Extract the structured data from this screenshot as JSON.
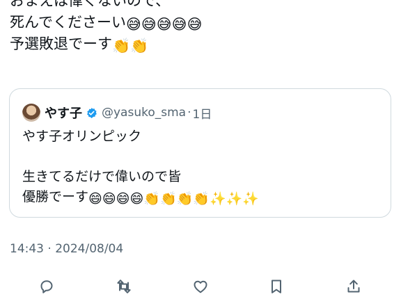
{
  "tweet": {
    "lines": [
      {
        "text": "おまえは偉くないので、",
        "emojis": []
      },
      {
        "text": "死んでくださーい",
        "emojis": [
          "😅",
          "😅",
          "😅",
          "😅",
          "😅"
        ]
      },
      {
        "text": "予選敗退でーす",
        "emojis": [
          "👏",
          "👏"
        ]
      }
    ]
  },
  "quote": {
    "author": "やす子",
    "handle": "@yasuko_sma",
    "separator": "·",
    "age": "1日",
    "line1": "やす子オリンピック",
    "line2": "生きてるだけで偉いので皆",
    "line3": "優勝でーす",
    "line3_emojis": [
      "😄",
      "😄",
      "😄",
      "😄",
      "👏",
      "👏",
      "👏",
      "👏",
      "✨",
      "✨",
      "✨"
    ]
  },
  "timestamp": "14:43 · 2024/08/04",
  "actions": [
    {
      "name": "reply",
      "icon": "reply-icon"
    },
    {
      "name": "retweet",
      "icon": "retweet-icon"
    },
    {
      "name": "like",
      "icon": "heart-icon"
    },
    {
      "name": "bookmark",
      "icon": "bookmark-icon"
    },
    {
      "name": "share",
      "icon": "share-icon"
    }
  ],
  "colors": {
    "text": "#0f1419",
    "secondary": "#536471",
    "border": "#cfd9de",
    "verified": "#1d9bf0",
    "icon": "#536471"
  }
}
